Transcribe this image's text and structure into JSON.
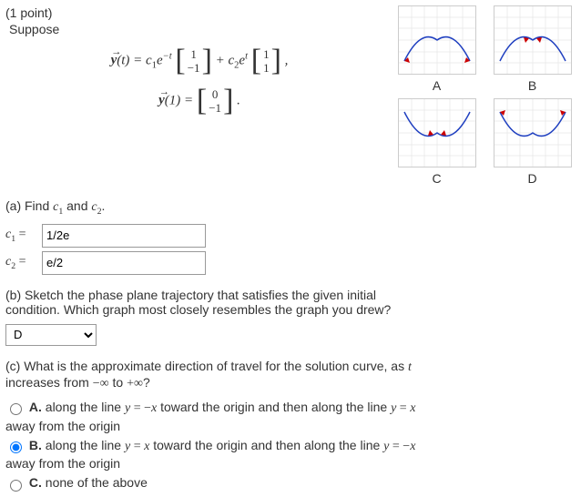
{
  "points": "(1 point)",
  "suppose": "Suppose",
  "eq1_lhs": "y(t) = c",
  "eq1_sub1": "1",
  "eq1_mid": "e",
  "eq1_exp1": "−t",
  "eq1_plus": " + c",
  "eq1_sub2": "2",
  "eq1_exp2": "t",
  "eq1_comma": " ,",
  "vec1_top": "1",
  "vec1_bot": "−1",
  "vec2_top": "1",
  "vec2_bot": "1",
  "eq2_lhs": "y(1) = ",
  "vec3_top": "0",
  "vec3_bot": "−1",
  "eq2_period": " .",
  "partA": "(a) Find c₁ and c₂.",
  "c1_label": "c₁ = ",
  "c1_value": "1/2e",
  "c2_label": "c₂ = ",
  "c2_value": "e/2",
  "partB": "(b) Sketch the phase plane trajectory that satisfies the given initial condition. Which graph most closely resembles the graph you drew?",
  "dropdown_value": "D",
  "partC": "(c) What is the approximate direction of travel for the solution curve, as t increases from −∞ to +∞?",
  "optA": "A. along the line y = −x toward the origin and then along the line y = x away from the origin",
  "optB": "B. along the line y = x toward the origin and then along the line y = −x away from the origin",
  "optC": "C. none of the above",
  "labelA": "A",
  "labelB": "B",
  "labelC": "C",
  "labelD": "D",
  "chart_data": [
    {
      "type": "curve",
      "id": "A",
      "desc": "two arcs opening downward meeting at origin, arrow tips pointing outward along y=-x/ y=x lines"
    },
    {
      "type": "curve",
      "id": "B",
      "desc": "two arcs opening downward, similar to A but arrows reversed"
    },
    {
      "type": "curve",
      "id": "C",
      "desc": "two arcs opening upward meeting at origin"
    },
    {
      "type": "curve",
      "id": "D",
      "desc": "two arcs opening upward, V-shape, arrows outward"
    }
  ]
}
